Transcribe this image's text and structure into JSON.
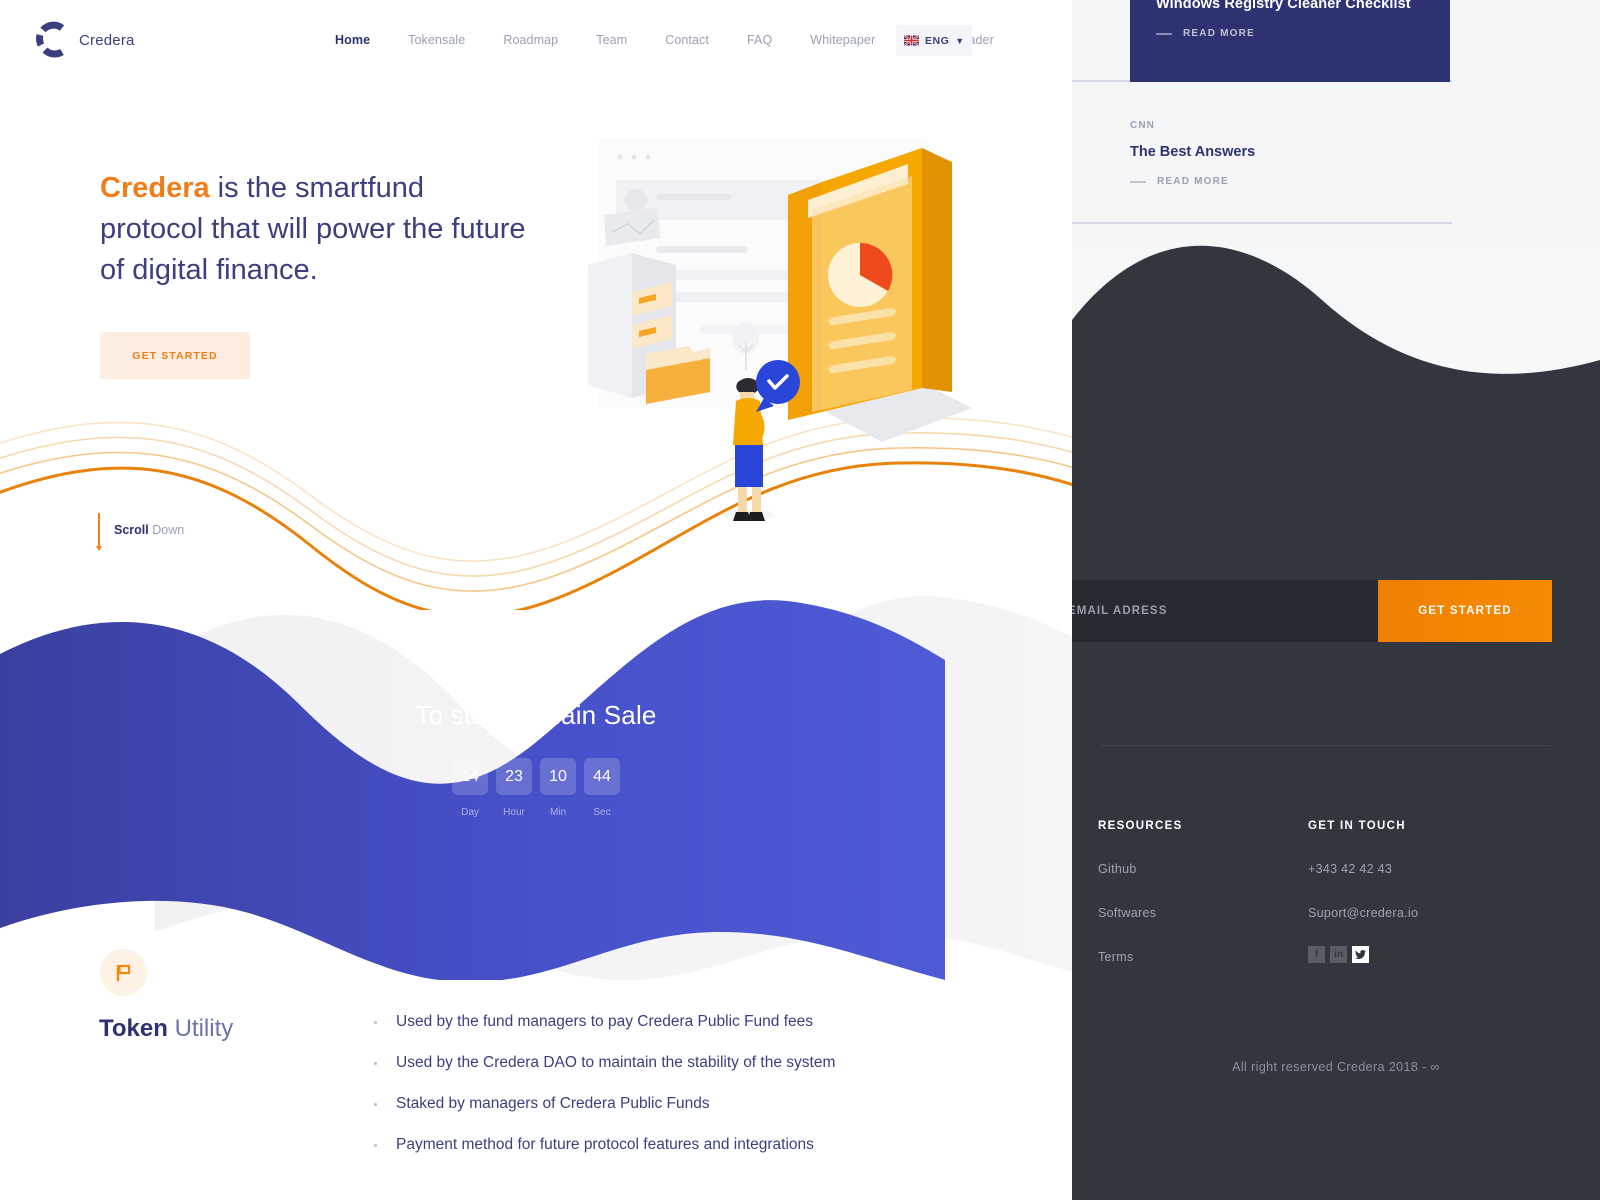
{
  "colors": {
    "brand_navy": "#2d3270",
    "accent_orange": "#ef7d1a",
    "wave_blue": "#4650c8",
    "footer_dark": "#32363f"
  },
  "navbar": {
    "brand_name": "Credera",
    "links": [
      {
        "label": "Home",
        "active": true
      },
      {
        "label": "Tokensale",
        "active": false
      },
      {
        "label": "Roadmap",
        "active": false
      },
      {
        "label": "Team",
        "active": false
      },
      {
        "label": "Contact",
        "active": false
      },
      {
        "label": "FAQ",
        "active": false
      },
      {
        "label": "Whitepaper",
        "active": false
      },
      {
        "label": "Visit CoTrader",
        "active": false
      }
    ],
    "language": {
      "code": "ENG",
      "chevron": "⌄"
    }
  },
  "hero": {
    "heading_accent": "Credera",
    "heading_rest": " is the smartfund protocol that will power the future of digital finance.",
    "cta_label": "GET STARTED",
    "scroll_bold": "Scroll",
    "scroll_rest": " Down"
  },
  "countdown": {
    "title": "To start of Main Sale",
    "units": [
      {
        "value": "14",
        "label": "Day"
      },
      {
        "value": "23",
        "label": "Hour"
      },
      {
        "value": "10",
        "label": "Min"
      },
      {
        "value": "44",
        "label": "Sec"
      }
    ]
  },
  "token_utility": {
    "heading_bold": "Token",
    "heading_light": " Utility",
    "items": [
      "Used by the fund managers to pay Credera Public Fund fees",
      "Used by the Credera DAO to maintain the stability of the system",
      "Staked by managers of Credera Public Funds",
      "Payment method for future protocol features and integrations"
    ]
  },
  "right_panel": {
    "news": [
      {
        "source": "",
        "title": "Windows Registry Cleaner Checklist",
        "read_more": "READ MORE"
      },
      {
        "source": "CNN",
        "title": "The Best Answers",
        "read_more": "READ MORE"
      }
    ],
    "newsletter": {
      "placeholder": "EMAIL ADRESS",
      "value": "",
      "cta_label": "GET STARTED"
    },
    "footer": {
      "columns": [
        {
          "title": "RESOURCES",
          "links": [
            "Github",
            "Softwares",
            "Terms"
          ]
        },
        {
          "title": "GET IN TOUCH",
          "phone": "+343 42 42 43",
          "email": "Suport@credera.io"
        }
      ],
      "social": [
        {
          "name": "facebook",
          "glyph": "f",
          "state": "muted"
        },
        {
          "name": "linkedin",
          "glyph": "in",
          "state": "muted"
        },
        {
          "name": "twitter",
          "glyph": "ᴠ",
          "state": "active"
        }
      ],
      "copyright": "All right reserved Credera 2018 - ∞"
    }
  }
}
